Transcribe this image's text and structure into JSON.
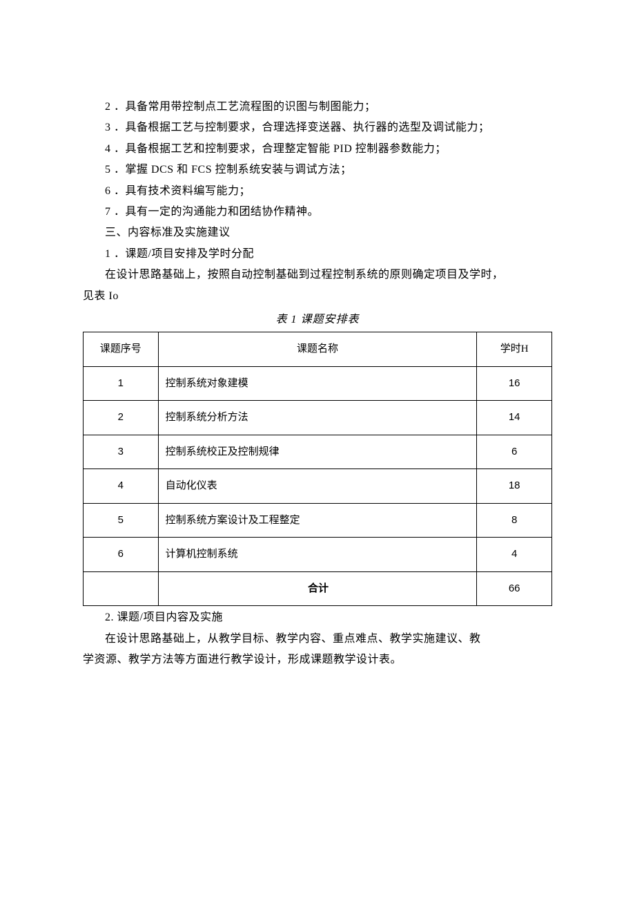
{
  "lines": {
    "l2": "2 ．具备常用带控制点工艺流程图的识图与制图能力；",
    "l3": "3 ．具备根据工艺与控制要求，合理选择变送器、执行器的选型及调试能力；",
    "l4": "4 ．具备根据工艺和控制要求，合理整定智能 PID 控制器参数能力；",
    "l5": "5 ．掌握 DCS 和 FCS 控制系统安装与调试方法；",
    "l6": "6 ．具有技术资料编写能力；",
    "l7": "7 ．具有一定的沟通能力和团结协作精神。",
    "section3": "三、内容标准及实施建议",
    "item1": "1 ．课题/项目安排及学时分配",
    "desc1a": "在设计思路基础上，按照自动控制基础到过程控制系统的原则确定项目及学时，",
    "desc1b": "见表 Io",
    "tableCaption": "表 1 课题安排表",
    "item2": "2. 课题/项目内容及实施",
    "desc2a": "在设计思路基础上，从教学目标、教学内容、重点难点、教学实施建议、教",
    "desc2b": "学资源、教学方法等方面进行教学设计，形成课题教学设计表。"
  },
  "table": {
    "headers": {
      "seq": "课题序号",
      "name": "课题名称",
      "hours": "学时H"
    },
    "rows": [
      {
        "seq": "1",
        "name": "控制系统对象建模",
        "hours": "16"
      },
      {
        "seq": "2",
        "name": "控制系统分析方法",
        "hours": "14"
      },
      {
        "seq": "3",
        "name": "控制系统校正及控制规律",
        "hours": "6"
      },
      {
        "seq": "4",
        "name": "自动化仪表",
        "hours": "18"
      },
      {
        "seq": "5",
        "name": "控制系统方案设计及工程整定",
        "hours": "8"
      },
      {
        "seq": "6",
        "name": "计算机控制系统",
        "hours": "4"
      }
    ],
    "total": {
      "label": "合计",
      "hours": "66"
    }
  }
}
